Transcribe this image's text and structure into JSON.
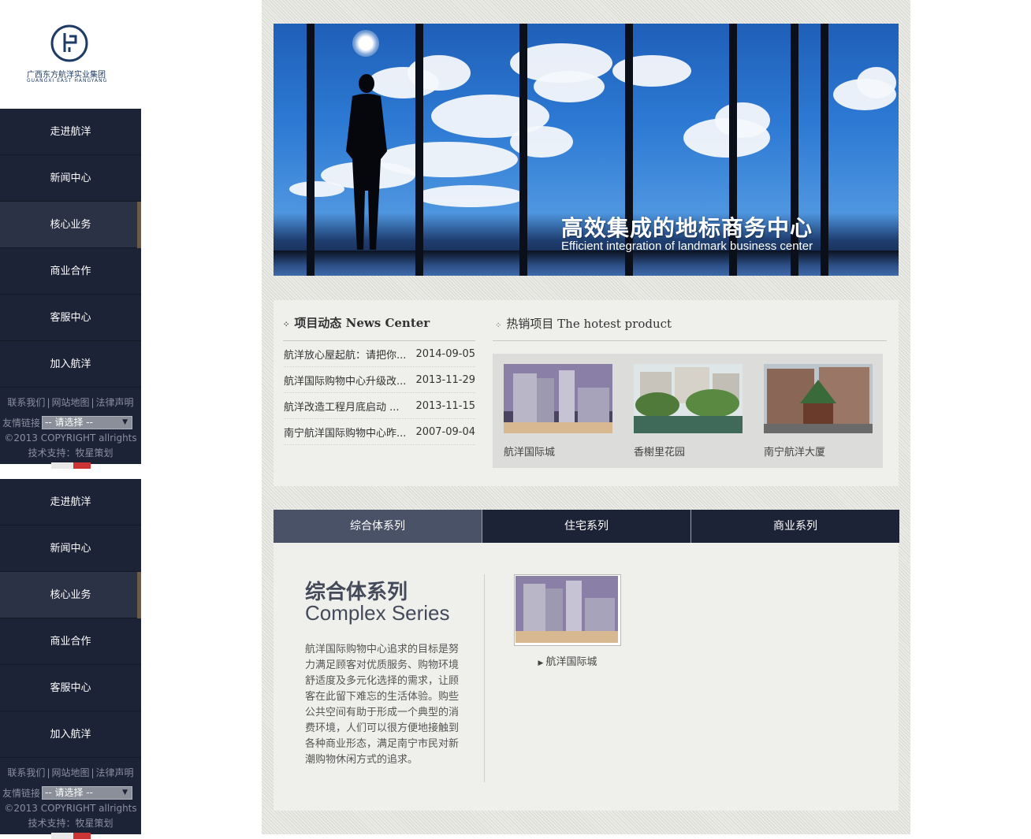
{
  "logo": {
    "name_cn": "广西东方航洋实业集团",
    "name_en": "GUANGXI EAST HANGYANG"
  },
  "sidebar": {
    "items": [
      {
        "label": "走进航洋"
      },
      {
        "label": "新闻中心"
      },
      {
        "label": "核心业务",
        "active": true
      },
      {
        "label": "商业合作"
      },
      {
        "label": "客服中心"
      },
      {
        "label": "加入航洋"
      }
    ],
    "links": [
      "联系我们",
      "网站地图",
      "法律声明"
    ],
    "friend_label": "友情链接",
    "friend_select": "-- 请选择 --",
    "copyright": "©2013 COPYRIGHT allrights",
    "tech": "技术支持：牧星策划"
  },
  "banner": {
    "title": "高效集成的地标商务中心",
    "subtitle": "Efficient integration of landmark business center"
  },
  "news": {
    "heading": "项目动态 News Center",
    "items": [
      {
        "title": "航洋放心屋起航：请把你...",
        "date": "2014-09-05"
      },
      {
        "title": "航洋国际购物中心升级改...",
        "date": "2013-11-29"
      },
      {
        "title": "航洋改造工程月底启动 ...",
        "date": "2013-11-15"
      },
      {
        "title": "南宁航洋国际购物中心昨...",
        "date": "2007-09-04"
      }
    ]
  },
  "hot": {
    "heading": "热销项目 The hotest product",
    "products": [
      {
        "name": "航洋国际城"
      },
      {
        "name": "香榭里花园"
      },
      {
        "name": "南宁航洋大厦"
      }
    ]
  },
  "tabs": [
    {
      "label": "综合体系列",
      "active": true
    },
    {
      "label": "住宅系列"
    },
    {
      "label": "商业系列"
    }
  ],
  "series": {
    "title_cn": "综合体系列",
    "title_en": "Complex Series",
    "description": "航洋国际购物中心追求的目标是努力满足顾客对优质服务、购物环境舒适度及多元化选择的需求，让顾客在此留下难忘的生活体验。购些公共空间有助于形成一个典型的消费环境，人们可以很方便地接触到各种商业形态，满足南宁市民对新潮购物休闲方式的追求。",
    "item": {
      "name": "航洋国际城"
    }
  }
}
